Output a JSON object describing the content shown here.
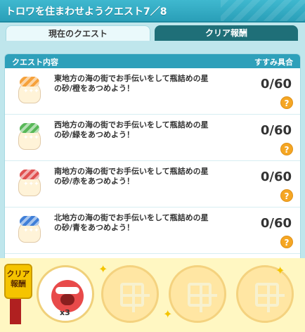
{
  "window": {
    "title": "トロワを住まわせようクエスト7／8"
  },
  "tabs": [
    {
      "label": "現在のクエスト",
      "active": true
    },
    {
      "label": "クリア報酬",
      "active": false
    }
  ],
  "list": {
    "header_left": "クエスト内容",
    "header_right": "すすみ具合",
    "rows": [
      {
        "text": "東地方の海の街でお手伝いをして瓶詰めの星の砂/橙をあつめよう！",
        "progress": "0/60",
        "color": "orange"
      },
      {
        "text": "西地方の海の街でお手伝いをして瓶詰めの星の砂/緑をあつめよう！",
        "progress": "0/60",
        "color": "green"
      },
      {
        "text": "南地方の海の街でお手伝いをして瓶詰めの星の砂/赤をあつめよう！",
        "progress": "0/60",
        "color": "red"
      },
      {
        "text": "北地方の海の街でお手伝いをして瓶詰めの星の砂/青をあつめよう！",
        "progress": "0/60",
        "color": "blue"
      }
    ],
    "help_label": "?"
  },
  "reward": {
    "label": "クリア報酬",
    "item_count": "x3"
  },
  "colors": {
    "orange": "#f6a13a",
    "green": "#58b858",
    "red": "#e05050",
    "blue": "#3f7fd8"
  }
}
